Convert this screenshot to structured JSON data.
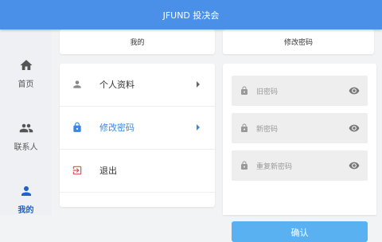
{
  "header": {
    "title": "JFUND 投决会"
  },
  "sidebar": {
    "items": [
      {
        "label": "首页",
        "icon": "home-icon"
      },
      {
        "label": "联系人",
        "icon": "contacts-icon"
      },
      {
        "label": "我的",
        "icon": "person-icon"
      }
    ],
    "active_index": 2
  },
  "tabs": {
    "mine": "我的",
    "change_password": "修改密码"
  },
  "menu": {
    "items": [
      {
        "label": "个人资料",
        "icon": "person-icon"
      },
      {
        "label": "修改密码",
        "icon": "lock-icon"
      },
      {
        "label": "退出",
        "icon": "exit-icon"
      }
    ]
  },
  "form": {
    "old_password": {
      "placeholder": "旧密码"
    },
    "new_password": {
      "placeholder": "新密码"
    },
    "repeat_password": {
      "placeholder": "重复新密码"
    },
    "confirm_label": "确认"
  },
  "colors": {
    "header": "#4a90e8",
    "accent": "#3a86e0",
    "exit_icon": "#e05050",
    "confirm_button": "#5ab1f2"
  }
}
